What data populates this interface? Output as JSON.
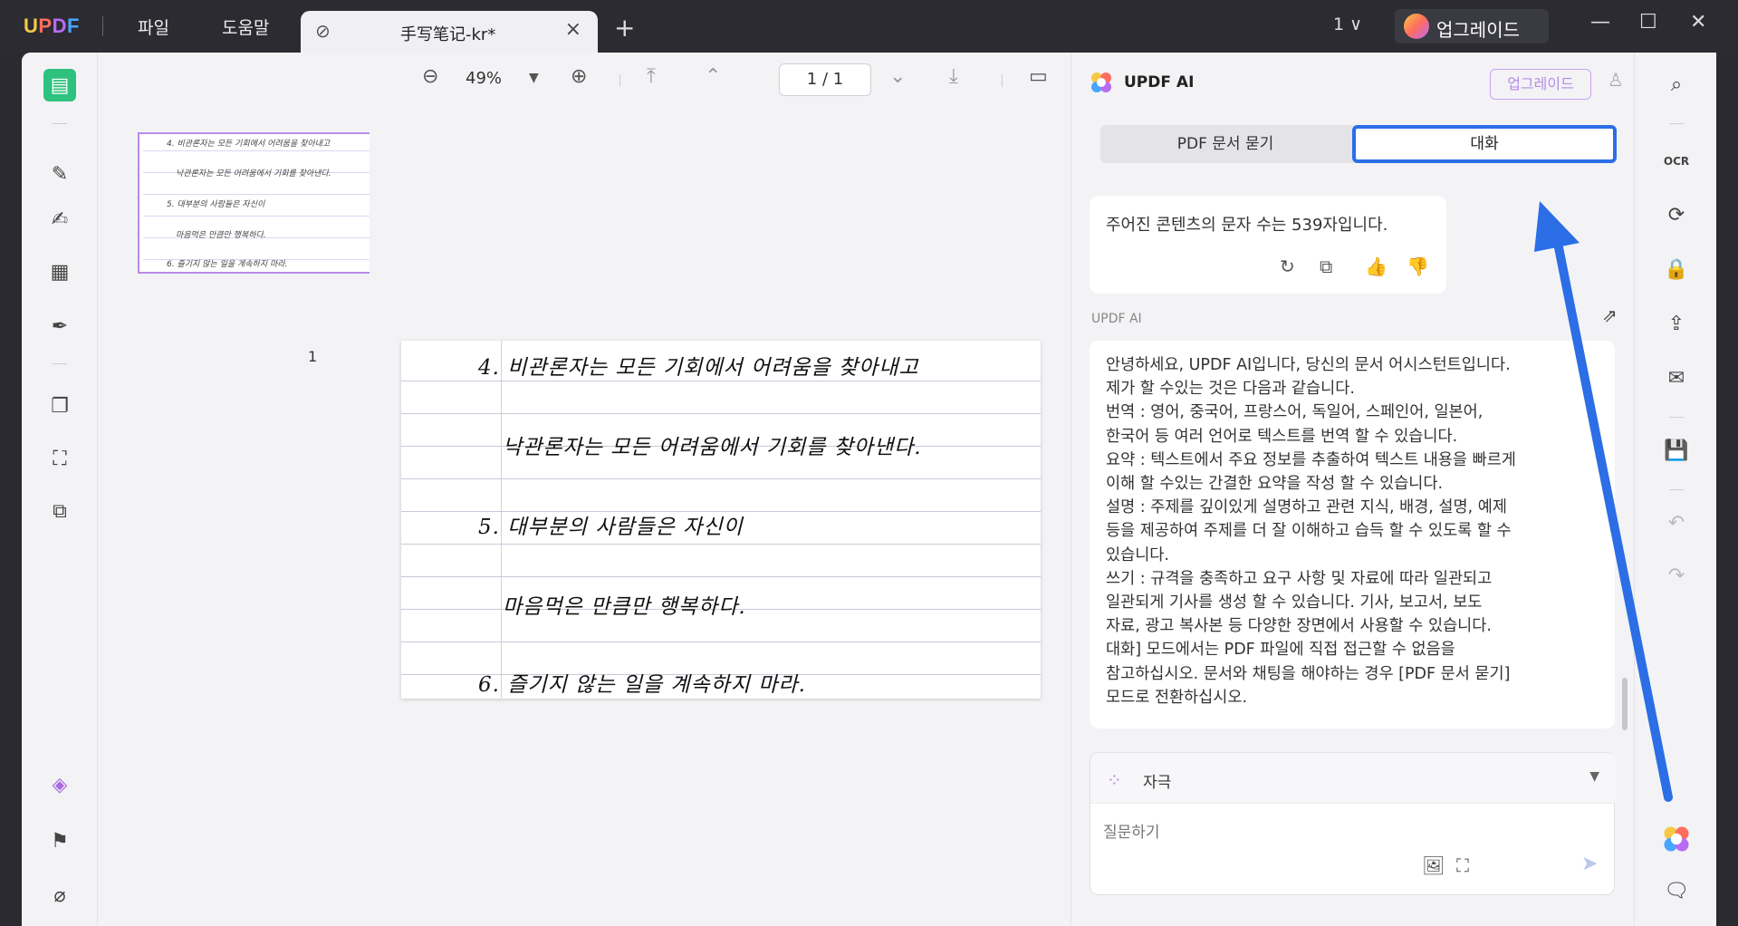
{
  "titlebar": {
    "logo": "UPDF",
    "menu": [
      "파일",
      "도움말"
    ],
    "tab_title": "手写笔记-kr*",
    "tab_close": "×",
    "add_tab": "+",
    "page_indicator": "1 ∨",
    "upgrade": "업그레이드",
    "minimize": "—",
    "maximize": "☐",
    "close": "✕"
  },
  "thumbnails": {
    "page_number": "1",
    "lines": [
      "4. 비관론자는 모든 기회에서 어려움을 찾아내고",
      "낙관론자는 모든 어려움에서 기회를 찾아낸다.",
      "5. 대부분의 사람들은 자신이",
      "마음먹은 만큼만 행복하다.",
      "6. 즐기지 않는 일을 계속하지 마라."
    ]
  },
  "doc_toolbar": {
    "zoom": "49%",
    "page": "1 / 1"
  },
  "document": {
    "lines": [
      "4. 비관론자는 모든 기회에서 어려움을 찾아내고",
      "낙관론자는 모든 어려움에서 기회를 찾아낸다.",
      "5. 대부분의 사람들은 자신이",
      "마음먹은 만큼만 행복하다.",
      "6. 즐기지 않는 일을 계속하지 마라."
    ]
  },
  "ai": {
    "title": "UPDF AI",
    "upgrade": "업그레이드",
    "tabs": [
      "PDF 문서 묻기",
      "대화"
    ],
    "message1": "주어진 콘텐츠의 문자 수는 539자입니다.",
    "sender": "UPDF AI",
    "message2": "안녕하세요, UPDF AI입니다, 당신의 문서 어시스턴트입니다.\n제가 할 수있는 것은 다음과 같습니다.\n번역 : 영어, 중국어, 프랑스어, 독일어, 스페인어, 일본어,\n한국어 등 여러 언어로 텍스트를 번역 할 수 있습니다.\n요약 : 텍스트에서 주요 정보를 추출하여 텍스트 내용을 빠르게\n이해 할 수있는 간결한 요약을 작성 할 수 있습니다.\n설명 : 주제를 깊이있게 설명하고 관련 지식, 배경, 설명, 예제\n등을 제공하여 주제를 더 잘 이해하고 습득 할 수 있도록 할 수\n있습니다.\n쓰기 : 규격을 충족하고 요구 사항 및 자료에 따라 일관되고\n일관되게 기사를 생성 할 수 있습니다. 기사, 보고서, 보도\n자료, 광고 복사본 등 다양한 장면에서 사용할 수 있습니다.\n대화] 모드에서는 PDF 파일에 직접 접근할 수 없음을\n참고하십시오. 문서와 채팅을 해야하는 경우 [PDF 문서 묻기]\n모드로 전환하십시오.",
    "prompt_label": "자극",
    "prompt_placeholder": "질문하기"
  },
  "colors": {
    "accent_blue": "#2b6ee6",
    "active_tool": "#2ec27e",
    "upgrade_purple": "#b58be6"
  }
}
